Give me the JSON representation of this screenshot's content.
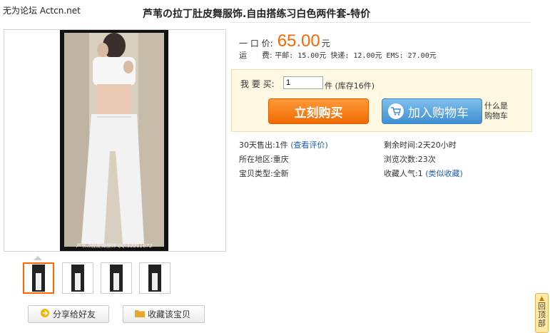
{
  "watermark": "无为论坛 Actcn.net",
  "product": {
    "title": "芦苇の拉丁肚皮舞服饰.自由搭练习白色两件套-特价",
    "photo_caption": "芦苇の肚皮舞服饰 QQ:12211672"
  },
  "price": {
    "label": "一 口 价:",
    "value": "65.00",
    "unit": "元"
  },
  "shipping": {
    "label": "运      费:",
    "text": "平邮: 15.00元 快递: 12.00元 EMS: 27.00元"
  },
  "buy": {
    "qty_label": "我 要 买:",
    "qty_value": "1",
    "stock_text": "件 (库存16件)",
    "buy_now": "立刻购买",
    "add_cart": "加入购物车",
    "what_cart_line1": "什么是",
    "what_cart_line2": "购物车"
  },
  "info_left": [
    {
      "label": "30天售出:",
      "value": "1件",
      "link": "(查看评价)"
    },
    {
      "label": "所在地区:",
      "value": "重庆",
      "link": ""
    },
    {
      "label": "宝贝类型:",
      "value": "全新",
      "link": ""
    }
  ],
  "info_right": [
    {
      "label": "剩余时间:",
      "value": "2天20小时",
      "link": ""
    },
    {
      "label": "浏览次数:",
      "value": "23次",
      "link": ""
    },
    {
      "label": "收藏人气:",
      "value": "1",
      "link": "(类似收藏)"
    }
  ],
  "actions": {
    "share": "分享给好友",
    "favorite": "收藏该宝贝"
  },
  "back_to_top": [
    "回",
    "顶",
    "部"
  ],
  "colors": {
    "price": "#ff6600",
    "buy_button": "#f06a00",
    "cart_button": "#3f8fd2",
    "link": "#1f5fa8"
  }
}
